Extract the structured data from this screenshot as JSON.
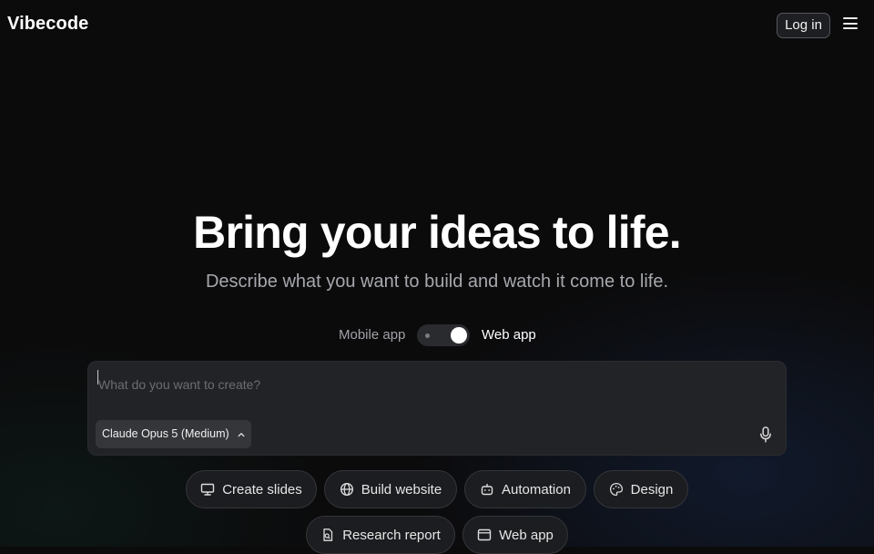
{
  "header": {
    "logo": "Vibecode",
    "login_label": "Log in",
    "menu_icon": "hamburger-menu-icon"
  },
  "hero": {
    "title": "Bring your ideas to life.",
    "subtitle": "Describe what you want to build and watch it come to life."
  },
  "mode_toggle": {
    "left_label": "Mobile app",
    "right_label": "Web app",
    "selected": "Web app"
  },
  "prompt": {
    "placeholder": "What do you want to create?",
    "value": "",
    "model_label": "Claude Opus 5 (Medium)",
    "mic_icon": "microphone-icon"
  },
  "chips": [
    {
      "label": "Create slides",
      "icon": "presentation-icon"
    },
    {
      "label": "Build website",
      "icon": "globe-icon"
    },
    {
      "label": "Automation",
      "icon": "robot-icon"
    },
    {
      "label": "Design",
      "icon": "palette-icon"
    },
    {
      "label": "Research report",
      "icon": "document-search-icon"
    },
    {
      "label": "Web app",
      "icon": "browser-window-icon"
    }
  ]
}
